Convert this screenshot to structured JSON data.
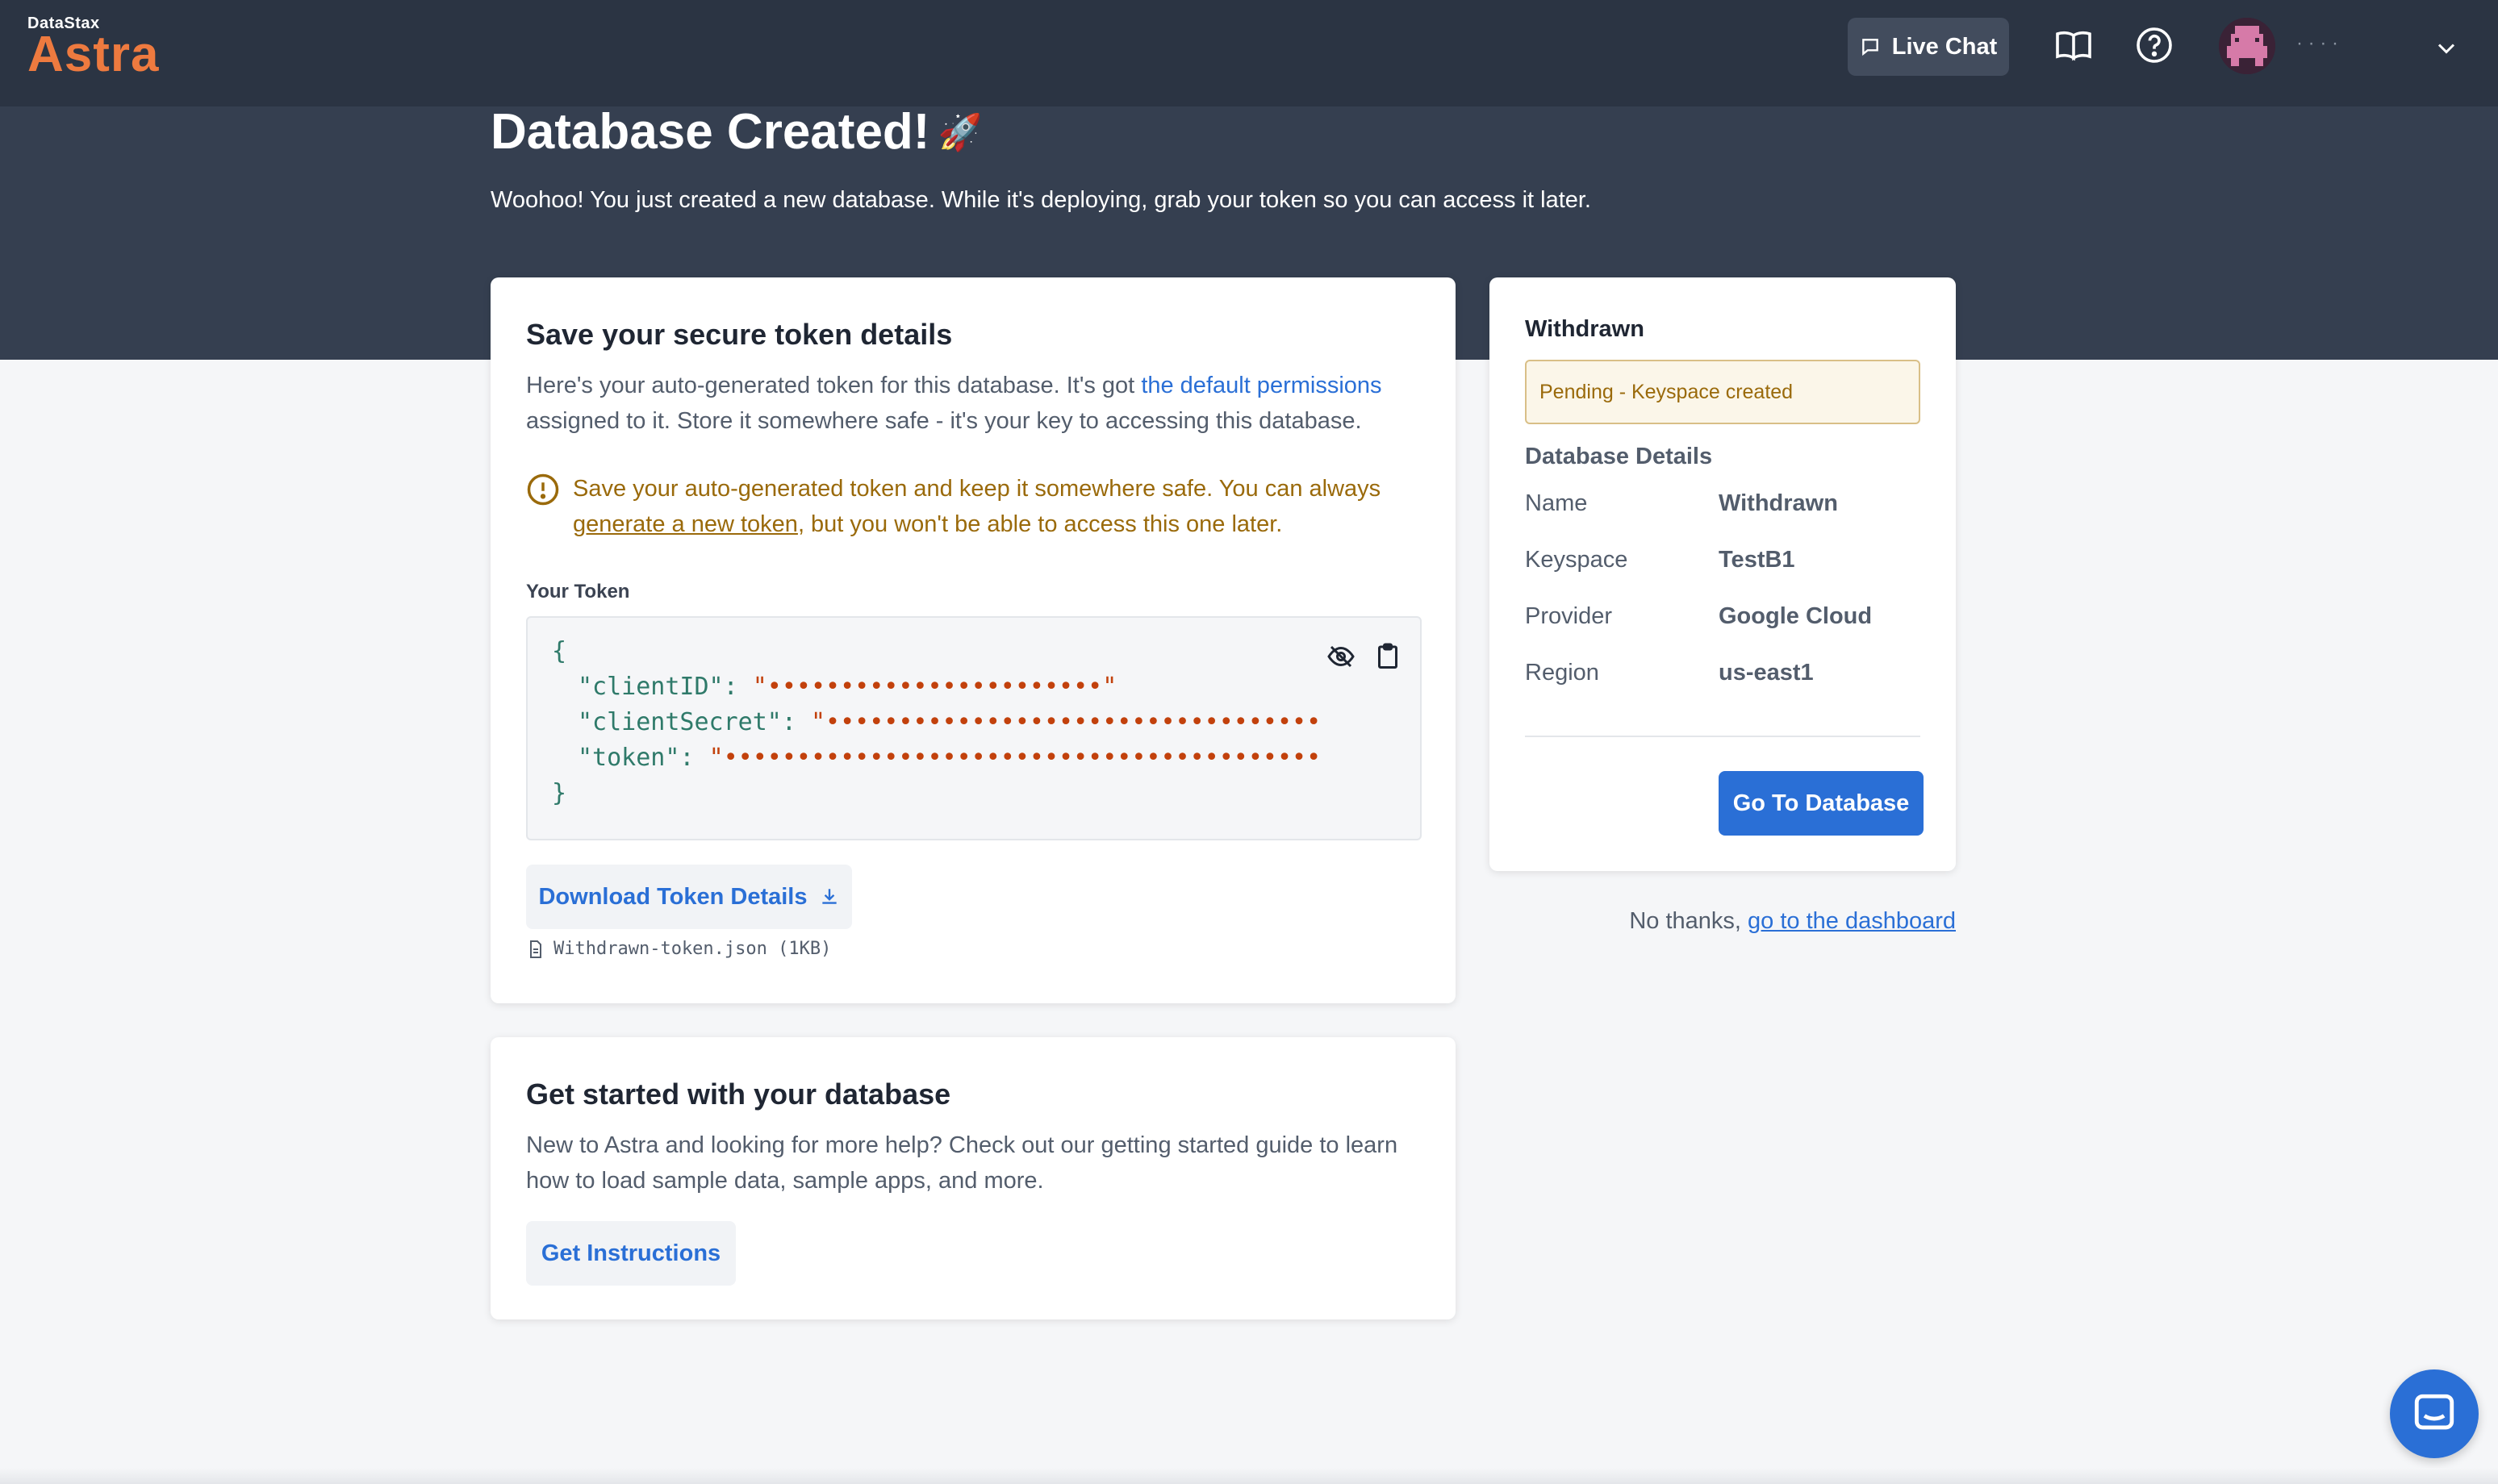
{
  "brand": {
    "company": "DataStax",
    "product": "Astra",
    "accent_color": "#ee7a3f"
  },
  "navbar": {
    "live_chat_label": "Live Chat",
    "live_chat_icon": "chat-icon",
    "docs_icon": "book-icon",
    "help_icon": "help-icon",
    "user_name": "· · · ·",
    "menu_icon": "chevron-down-icon"
  },
  "header": {
    "title": "Database Created!",
    "title_emoji": "🚀",
    "subtitle": "Woohoo! You just created a new database. While it's deploying, grab your token so you can access it later."
  },
  "token_card": {
    "title": "Save your secure token details",
    "intro_before": "Here's your auto-generated token for this database. It's got ",
    "intro_link": "the default permissions",
    "intro_after": " assigned to it. Store it somewhere safe - it's your key to accessing this database.",
    "warning_before": "Save your auto-generated token and keep it somewhere safe. You can always ",
    "warning_link": "generate a new token",
    "warning_after": ", but you won't be able to access this one later.",
    "token_label": "Your Token",
    "code": {
      "open": "{",
      "client_id_key": "\"clientID\": ",
      "client_id_value": "\"•••••••••••••••••••••••\"",
      "client_secret_key": "\"clientSecret\": ",
      "client_secret_value": "\"•••••••••••••••••••••••••••••••••••••••••••••••",
      "token_key": "\"token\": ",
      "token_value": "\"••••••••••••••••••••••••••••••••••••••••••••••••••",
      "close": "}"
    },
    "download_label": "Download Token Details",
    "file_name": "Withdrawn-token.json (1KB)"
  },
  "start_card": {
    "title": "Get started with your database",
    "text": "New to Astra and looking for more help? Check out our getting started guide to learn how to load sample data, sample apps, and more.",
    "button_label": "Get Instructions"
  },
  "side_card": {
    "db_name": "Withdrawn",
    "status": "Pending - Keyspace created",
    "details_heading": "Database Details",
    "details": [
      {
        "label": "Name",
        "value": "Withdrawn"
      },
      {
        "label": "Keyspace",
        "value": "TestB1"
      },
      {
        "label": "Provider",
        "value": "Google Cloud"
      },
      {
        "label": "Region",
        "value": "us-east1"
      }
    ],
    "go_button": "Go To Database"
  },
  "no_thanks": {
    "text": "No thanks, ",
    "link": "go to the dashboard"
  }
}
